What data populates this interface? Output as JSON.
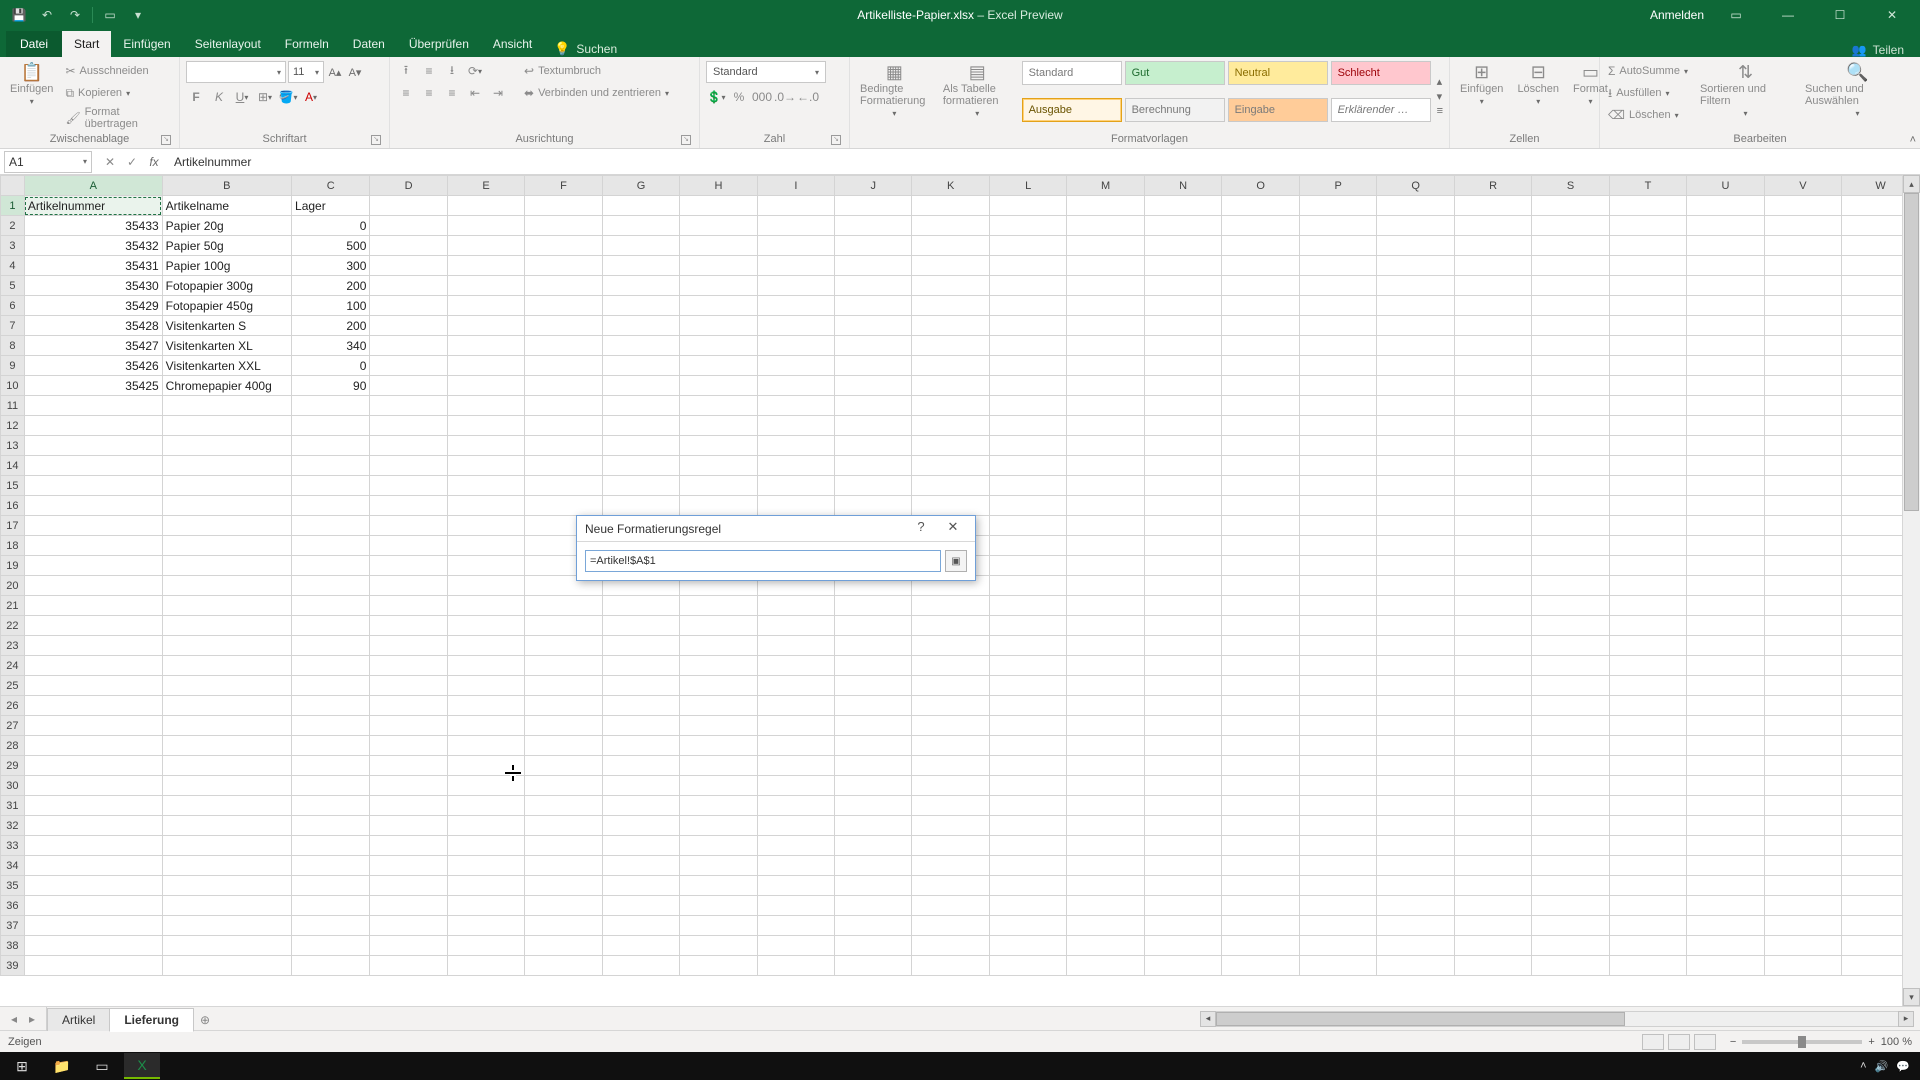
{
  "title": {
    "filename": "Artikelliste-Papier.xlsx",
    "app": "Excel Preview"
  },
  "account": {
    "signin": "Anmelden"
  },
  "ribbon": {
    "tabs": {
      "file": "Datei",
      "home": "Start",
      "insert": "Einfügen",
      "layout": "Seitenlayout",
      "formulas": "Formeln",
      "data": "Daten",
      "review": "Überprüfen",
      "view": "Ansicht",
      "search": "Suchen",
      "share": "Teilen"
    },
    "clipboard": {
      "label": "Zwischenablage",
      "paste": "Einfügen",
      "cut": "Ausschneiden",
      "copy": "Kopieren",
      "format_painter": "Format übertragen"
    },
    "font": {
      "label": "Schriftart",
      "name": "",
      "size": "11"
    },
    "alignment": {
      "label": "Ausrichtung",
      "wrap": "Textumbruch",
      "merge": "Verbinden und zentrieren"
    },
    "number": {
      "label": "Zahl",
      "format": "Standard"
    },
    "styles": {
      "label": "Formatvorlagen",
      "cond": "Bedingte Formatierung",
      "as_table": "Als Tabelle formatieren",
      "cells": {
        "standard": "Standard",
        "gut": "Gut",
        "neutral": "Neutral",
        "schlecht": "Schlecht",
        "ausgabe": "Ausgabe",
        "berechnung": "Berechnung",
        "eingabe": "Eingabe",
        "erklaerend": "Erklärender …"
      }
    },
    "cells_grp": {
      "label": "Zellen",
      "insert": "Einfügen",
      "delete": "Löschen",
      "format": "Format"
    },
    "editing": {
      "label": "Bearbeiten",
      "autosum": "AutoSumme",
      "fill": "Ausfüllen",
      "clear": "Löschen",
      "sort": "Sortieren und Filtern",
      "find": "Suchen und Auswählen"
    }
  },
  "formula_bar": {
    "name_box": "A1",
    "formula": "Artikelnummer"
  },
  "columns": [
    "A",
    "B",
    "C",
    "D",
    "E",
    "F",
    "G",
    "H",
    "I",
    "J",
    "K",
    "L",
    "M",
    "N",
    "O",
    "P",
    "Q",
    "R",
    "S",
    "T",
    "U",
    "V",
    "W"
  ],
  "col_widths": {
    "A": 140,
    "B": 130,
    "C": 80,
    "default": 80
  },
  "row_count": 39,
  "data": {
    "headers": {
      "a": "Artikelnummer",
      "b": "Artikelname",
      "c": "Lager"
    },
    "rows": [
      {
        "a": "35433",
        "b": "Papier 20g",
        "c": "0"
      },
      {
        "a": "35432",
        "b": "Papier 50g",
        "c": "500"
      },
      {
        "a": "35431",
        "b": "Papier 100g",
        "c": "300"
      },
      {
        "a": "35430",
        "b": "Fotopapier 300g",
        "c": "200"
      },
      {
        "a": "35429",
        "b": "Fotopapier 450g",
        "c": "100"
      },
      {
        "a": "35428",
        "b": "Visitenkarten S",
        "c": "200"
      },
      {
        "a": "35427",
        "b": "Visitenkarten XL",
        "c": "340"
      },
      {
        "a": "35426",
        "b": "Visitenkarten XXL",
        "c": "0"
      },
      {
        "a": "35425",
        "b": "Chromepapier 400g",
        "c": "90"
      }
    ]
  },
  "dialog": {
    "title": "Neue Formatierungsregel",
    "value": "=Artikel!$A$1",
    "help": "?",
    "close": "✕"
  },
  "sheets": {
    "s1": "Artikel",
    "s2": "Lieferung"
  },
  "status": {
    "mode": "Zeigen",
    "zoom": "100 %"
  }
}
